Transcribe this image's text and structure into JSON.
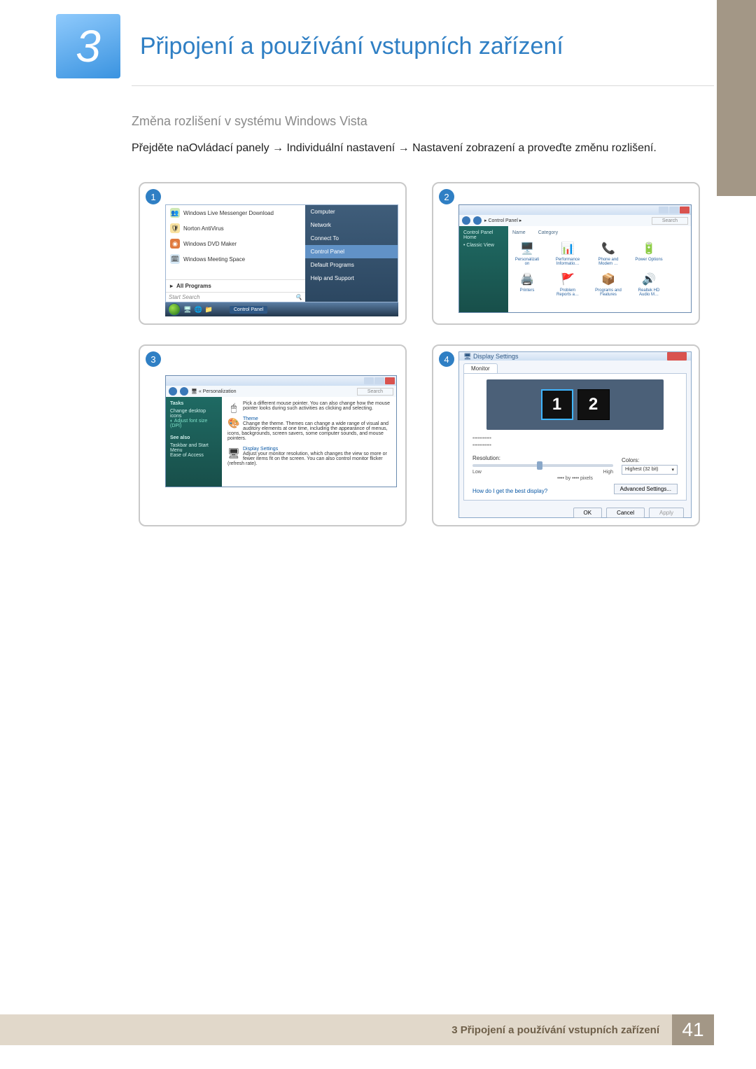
{
  "chapter": {
    "number": "3",
    "title": "Připojení a používání vstupních zařízení"
  },
  "section": {
    "subtitle": "Změna rozlišení v systému Windows Vista",
    "instruction": "Přejděte naOvládací panely → Individuální nastavení → Nastavení zobrazení a proveďte změnu rozlišení."
  },
  "steps": {
    "n1": "1",
    "n2": "2",
    "n3": "3",
    "n4": "4"
  },
  "startmenu": {
    "items": [
      {
        "label": "Windows Live Messenger Download"
      },
      {
        "label": "Norton AntiVirus"
      },
      {
        "label": "Windows DVD Maker"
      },
      {
        "label": "Windows Meeting Space"
      }
    ],
    "all_programs": "All Programs",
    "search_placeholder": "Start Search",
    "right": {
      "computer": "Computer",
      "network": "Network",
      "connect": "Connect To",
      "control_panel": "Control Panel",
      "default_programs": "Default Programs",
      "help": "Help and Support"
    },
    "taskbar_label": "Control Panel"
  },
  "control_panel": {
    "breadcrumb": "Control Panel",
    "search_placeholder": "Search",
    "side": {
      "home": "Control Panel Home",
      "classic": "Classic View"
    },
    "cols": {
      "name": "Name",
      "category": "Category"
    },
    "items": {
      "personalization": "Personalizati on",
      "performance": "Performance Informatio…",
      "phone": "Phone and Modem …",
      "power": "Power Options",
      "printers": "Printers",
      "problem": "Problem Reports a…",
      "programs": "Programs and Features",
      "realtek": "Realtek HD Audio M…"
    }
  },
  "personalization": {
    "breadcrumb": "Personalization",
    "search_placeholder": "Search",
    "side": {
      "tasks_hd": "Tasks",
      "task1": "Change desktop icons",
      "task2": "Adjust font size (DPI)",
      "seealso_hd": "See also",
      "sa1": "Taskbar and Start Menu",
      "sa2": "Ease of Access"
    },
    "mouse": {
      "desc": "Pick a different mouse pointer. You can also change how the mouse pointer looks during such activities as clicking and selecting."
    },
    "theme": {
      "title": "Theme",
      "desc": "Change the theme. Themes can change a wide range of visual and auditory elements at one time, including the appearance of menus, icons, backgrounds, screen savers, some computer sounds, and mouse pointers."
    },
    "display": {
      "title": "Display Settings",
      "desc": "Adjust your monitor resolution, which changes the view so more or fewer items fit on the screen. You can also control monitor flicker (refresh rate)."
    }
  },
  "display_settings": {
    "title": "Display Settings",
    "tab": "Monitor",
    "mon1": "1",
    "mon2": "2",
    "check1": "•••••••••••",
    "check2": "•••••••••••",
    "res_label": "Resolution:",
    "low": "Low",
    "high": "High",
    "px_line": "•••• by •••• pixels",
    "colors_label": "Colors:",
    "colors_value": "Highest (32 bit)",
    "help_link": "How do I get the best display?",
    "advanced": "Advanced Settings...",
    "ok": "OK",
    "cancel": "Cancel",
    "apply": "Apply"
  },
  "footer": {
    "text": "3 Připojení a používání vstupních zařízení",
    "page": "41"
  }
}
